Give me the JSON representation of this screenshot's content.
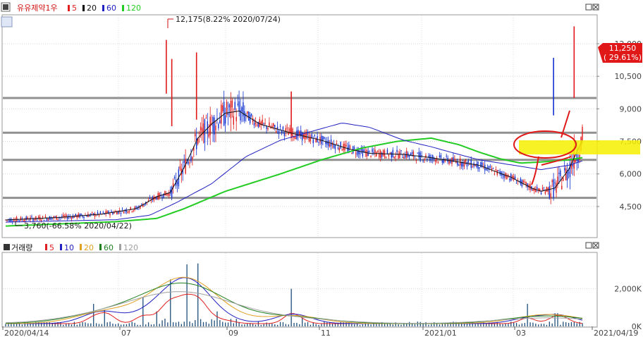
{
  "chart_data": {
    "type": "candlestick",
    "title": "유유제약1우",
    "legend": [
      {
        "label": "5",
        "color": "#e02020"
      },
      {
        "label": "20",
        "color": "#000000"
      },
      {
        "label": "60",
        "color": "#2020c0"
      },
      {
        "label": "120",
        "color": "#22cc22"
      }
    ],
    "y_ticks": [
      12000,
      10500,
      9000,
      7500,
      6000,
      4500
    ],
    "y_tick_labels": [
      "12,000",
      "10,500",
      "9,000",
      "7,500",
      "6,000",
      "4,500"
    ],
    "ylim": [
      3100,
      13300
    ],
    "x_tick_labels": [
      "2020/04/14",
      "07",
      "09",
      "11",
      "2021/01",
      "03",
      "2021/04/19"
    ],
    "horizontal_levels": [
      9500,
      7900,
      6650,
      4900
    ],
    "annotations": {
      "high": "12,175(8.22% 2020/07/24)",
      "low": "3,760(-66.58% 2020/04/22)"
    },
    "price_tag": {
      "price": "11,250",
      "change": "( 29.61%)"
    },
    "ma_path_points": {
      "ma20": [
        [
          0,
          3880
        ],
        [
          40,
          4000
        ],
        [
          70,
          4150
        ],
        [
          95,
          4400
        ],
        [
          110,
          4950
        ],
        [
          120,
          5150
        ],
        [
          130,
          6300
        ],
        [
          140,
          7650
        ],
        [
          150,
          8300
        ],
        [
          160,
          8800
        ],
        [
          170,
          8900
        ],
        [
          185,
          8300
        ],
        [
          210,
          7850
        ],
        [
          230,
          7550
        ],
        [
          250,
          7150
        ],
        [
          265,
          6950
        ],
        [
          290,
          6900
        ],
        [
          310,
          6750
        ],
        [
          330,
          6550
        ],
        [
          345,
          6400
        ],
        [
          355,
          6150
        ],
        [
          368,
          5850
        ],
        [
          375,
          5620
        ],
        [
          383,
          5350
        ],
        [
          390,
          5200
        ],
        [
          400,
          5350
        ],
        [
          410,
          6200
        ],
        [
          420,
          7550
        ]
      ],
      "ma60": [
        [
          0,
          3780
        ],
        [
          80,
          3890
        ],
        [
          105,
          4100
        ],
        [
          125,
          4700
        ],
        [
          150,
          5550
        ],
        [
          175,
          6800
        ],
        [
          200,
          7550
        ],
        [
          225,
          8000
        ],
        [
          245,
          8350
        ],
        [
          265,
          8150
        ],
        [
          290,
          7550
        ],
        [
          310,
          7250
        ],
        [
          330,
          6900
        ],
        [
          345,
          6650
        ],
        [
          360,
          6500
        ],
        [
          375,
          6350
        ],
        [
          390,
          6200
        ],
        [
          410,
          6400
        ],
        [
          420,
          6600
        ]
      ],
      "ma120": [
        [
          0,
          3600
        ],
        [
          80,
          3800
        ],
        [
          110,
          3950
        ],
        [
          130,
          4400
        ],
        [
          160,
          5200
        ],
        [
          200,
          6000
        ],
        [
          230,
          6650
        ],
        [
          260,
          7200
        ],
        [
          285,
          7500
        ],
        [
          310,
          7650
        ],
        [
          330,
          7350
        ],
        [
          345,
          7000
        ],
        [
          360,
          6700
        ],
        [
          375,
          6500
        ],
        [
          390,
          6550
        ],
        [
          410,
          6650
        ],
        [
          420,
          6750
        ]
      ]
    },
    "volume_panel": {
      "title": "거래량",
      "legend": [
        {
          "label": "5",
          "color": "#e02020"
        },
        {
          "label": "10",
          "color": "#2020c0"
        },
        {
          "label": "20",
          "color": "#e0a020"
        },
        {
          "label": "60",
          "color": "#208020"
        },
        {
          "label": "120",
          "color": "#a0a0a0"
        }
      ],
      "y_ticks": [
        2000000,
        0
      ],
      "y_tick_labels": [
        "2,000K",
        "0K"
      ],
      "ylim": [
        0,
        3900000
      ]
    },
    "volume_spikes": [
      [
        64,
        1200000
      ],
      [
        72,
        900000
      ],
      [
        75,
        1150000
      ],
      [
        100,
        1550000
      ],
      [
        110,
        800000
      ],
      [
        117,
        1450000
      ],
      [
        120,
        2500000
      ],
      [
        127,
        1950000
      ],
      [
        132,
        3300000
      ],
      [
        140,
        3350000
      ],
      [
        145,
        1450000
      ],
      [
        154,
        800000
      ],
      [
        164,
        400000
      ],
      [
        208,
        2000000
      ],
      [
        216,
        450000
      ],
      [
        380,
        1200000
      ],
      [
        400,
        700000
      ],
      [
        402,
        700000
      ],
      [
        407,
        650000
      ]
    ]
  }
}
